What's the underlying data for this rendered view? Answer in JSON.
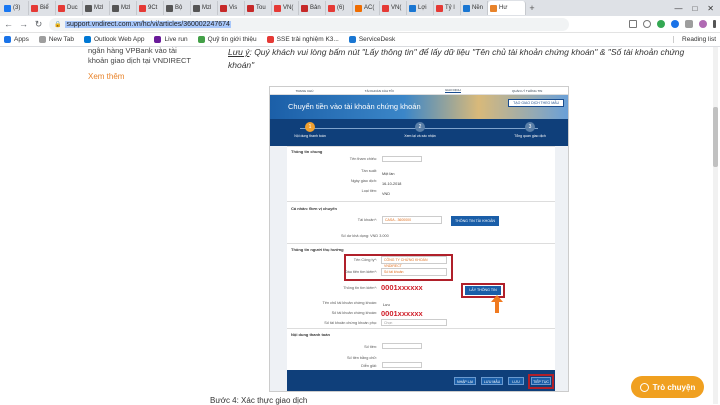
{
  "browser": {
    "tabs": [
      {
        "label": "(3)",
        "color": "#1877f2"
      },
      {
        "label": "Biể",
        "color": "#e53935"
      },
      {
        "label": "Duc",
        "color": "#e53935"
      },
      {
        "label": "Mzl",
        "color": "#555555"
      },
      {
        "label": "Mzl",
        "color": "#555555"
      },
      {
        "label": "9Ct",
        "color": "#e53935"
      },
      {
        "label": "Bộ",
        "color": "#555555"
      },
      {
        "label": "Mzl",
        "color": "#555555"
      },
      {
        "label": "Vis",
        "color": "#c62828"
      },
      {
        "label": "Tou",
        "color": "#c62828"
      },
      {
        "label": "VN(",
        "color": "#e53935"
      },
      {
        "label": "Bản",
        "color": "#c62828"
      },
      {
        "label": "(6)",
        "color": "#e53935"
      },
      {
        "label": "AC(",
        "color": "#ef6c00"
      },
      {
        "label": "VN(",
        "color": "#e53935"
      },
      {
        "label": "Lợi",
        "color": "#1976d2"
      },
      {
        "label": "Tỷ l",
        "color": "#e53935"
      },
      {
        "label": "Nền",
        "color": "#1976d2"
      },
      {
        "label": "Hư",
        "color": "#e8832a",
        "active": true
      }
    ],
    "url": "support.vndirect.com.vn/hc/vi/articles/360002247674",
    "bookmarks": [
      "Apps",
      "New Tab",
      "Outlook Web App",
      "Live run",
      "Quỹ tin giới thiệu",
      "SSE trải nghiệm K3...",
      "ServiceDesk"
    ],
    "reading_list": "Reading list"
  },
  "page": {
    "left_card_text": "ngân hàng VPBank vào tài khoản giao dịch tại VNDIRECT",
    "see_more": "Xem thêm",
    "note_prefix": "Lưu ý",
    "note_text": ": Quý khách vui lòng bấm nút \"Lấy thông tin\" để lấy dữ liệu \"Tên chủ tài khoản chứng khoán\" & \"Số tài khoản chứng khoán\"",
    "step4": "Bước 4: Xác thực giao dịch",
    "chat_label": "Trò chuyện"
  },
  "embedded": {
    "topnav": [
      "TRANG CHỦ",
      "TÀI KHOẢN CỦA TÔI",
      "GIAO DỊCH",
      "QUẢN LÝ THÔNG TIN"
    ],
    "title": "Chuyển tiền vào tài khoản chứng khoán",
    "banner_btn": "TẠO GIAO DỊCH THEO MẪU",
    "steps": [
      {
        "num": "1",
        "label": "Nội dung thanh toán"
      },
      {
        "num": "2",
        "label": "Xem lại và xác nhận"
      },
      {
        "num": "3",
        "label": "Tổng quan giao dịch"
      }
    ],
    "general": {
      "heading": "Thông tin chung",
      "labels": [
        "Tên tham chiếu:",
        "Tần suất:",
        "Ngày giao dịch:",
        "Loại tiền:"
      ],
      "values": [
        "",
        "Một lần",
        "16-10-2018",
        "VND"
      ]
    },
    "source": {
      "heading": "Cá nhân: Đơn vị chuyển",
      "account_label": "Tài khoản*:",
      "account_value": "CASA - 3600000",
      "btn": "THÔNG TIN TÀI KHOẢN",
      "balance": "Số dư khả dụng: VND 3.000"
    },
    "beneficiary": {
      "heading": "Thông tin người thụ hưởng",
      "company_label": "Tên Công ty*:",
      "company_value": "CÔNG TY CHỨNG KHOÁN VNDIRECT",
      "type_label": "Đầu tiên tìm kiếm*:",
      "type_value": "Số tài khoản",
      "acct_label": "Thông tin tìm kiếm*:",
      "acct_value": "0001xxxxxx",
      "get_btn": "LẤY THÔNG TIN",
      "owner_label": "Tên chủ tài khoản chứng khoán:",
      "owner_value": "Lưu",
      "secnum_label": "Số tài khoản chứng khoán:",
      "secnum_value": "0001xxxxxx",
      "sub_label": "Số tài khoản chứng khoán phụ:",
      "sub_value": "Chọn"
    },
    "payment": {
      "heading": "Nội dung thanh toán",
      "labels": [
        "Số tiền:",
        "Số tiền bằng chữ:",
        "Diễn giải:"
      ]
    },
    "buttons": [
      "NHẬP LẠI",
      "LƯU MẪU",
      "LƯU",
      "TIẾP TỤC"
    ]
  }
}
